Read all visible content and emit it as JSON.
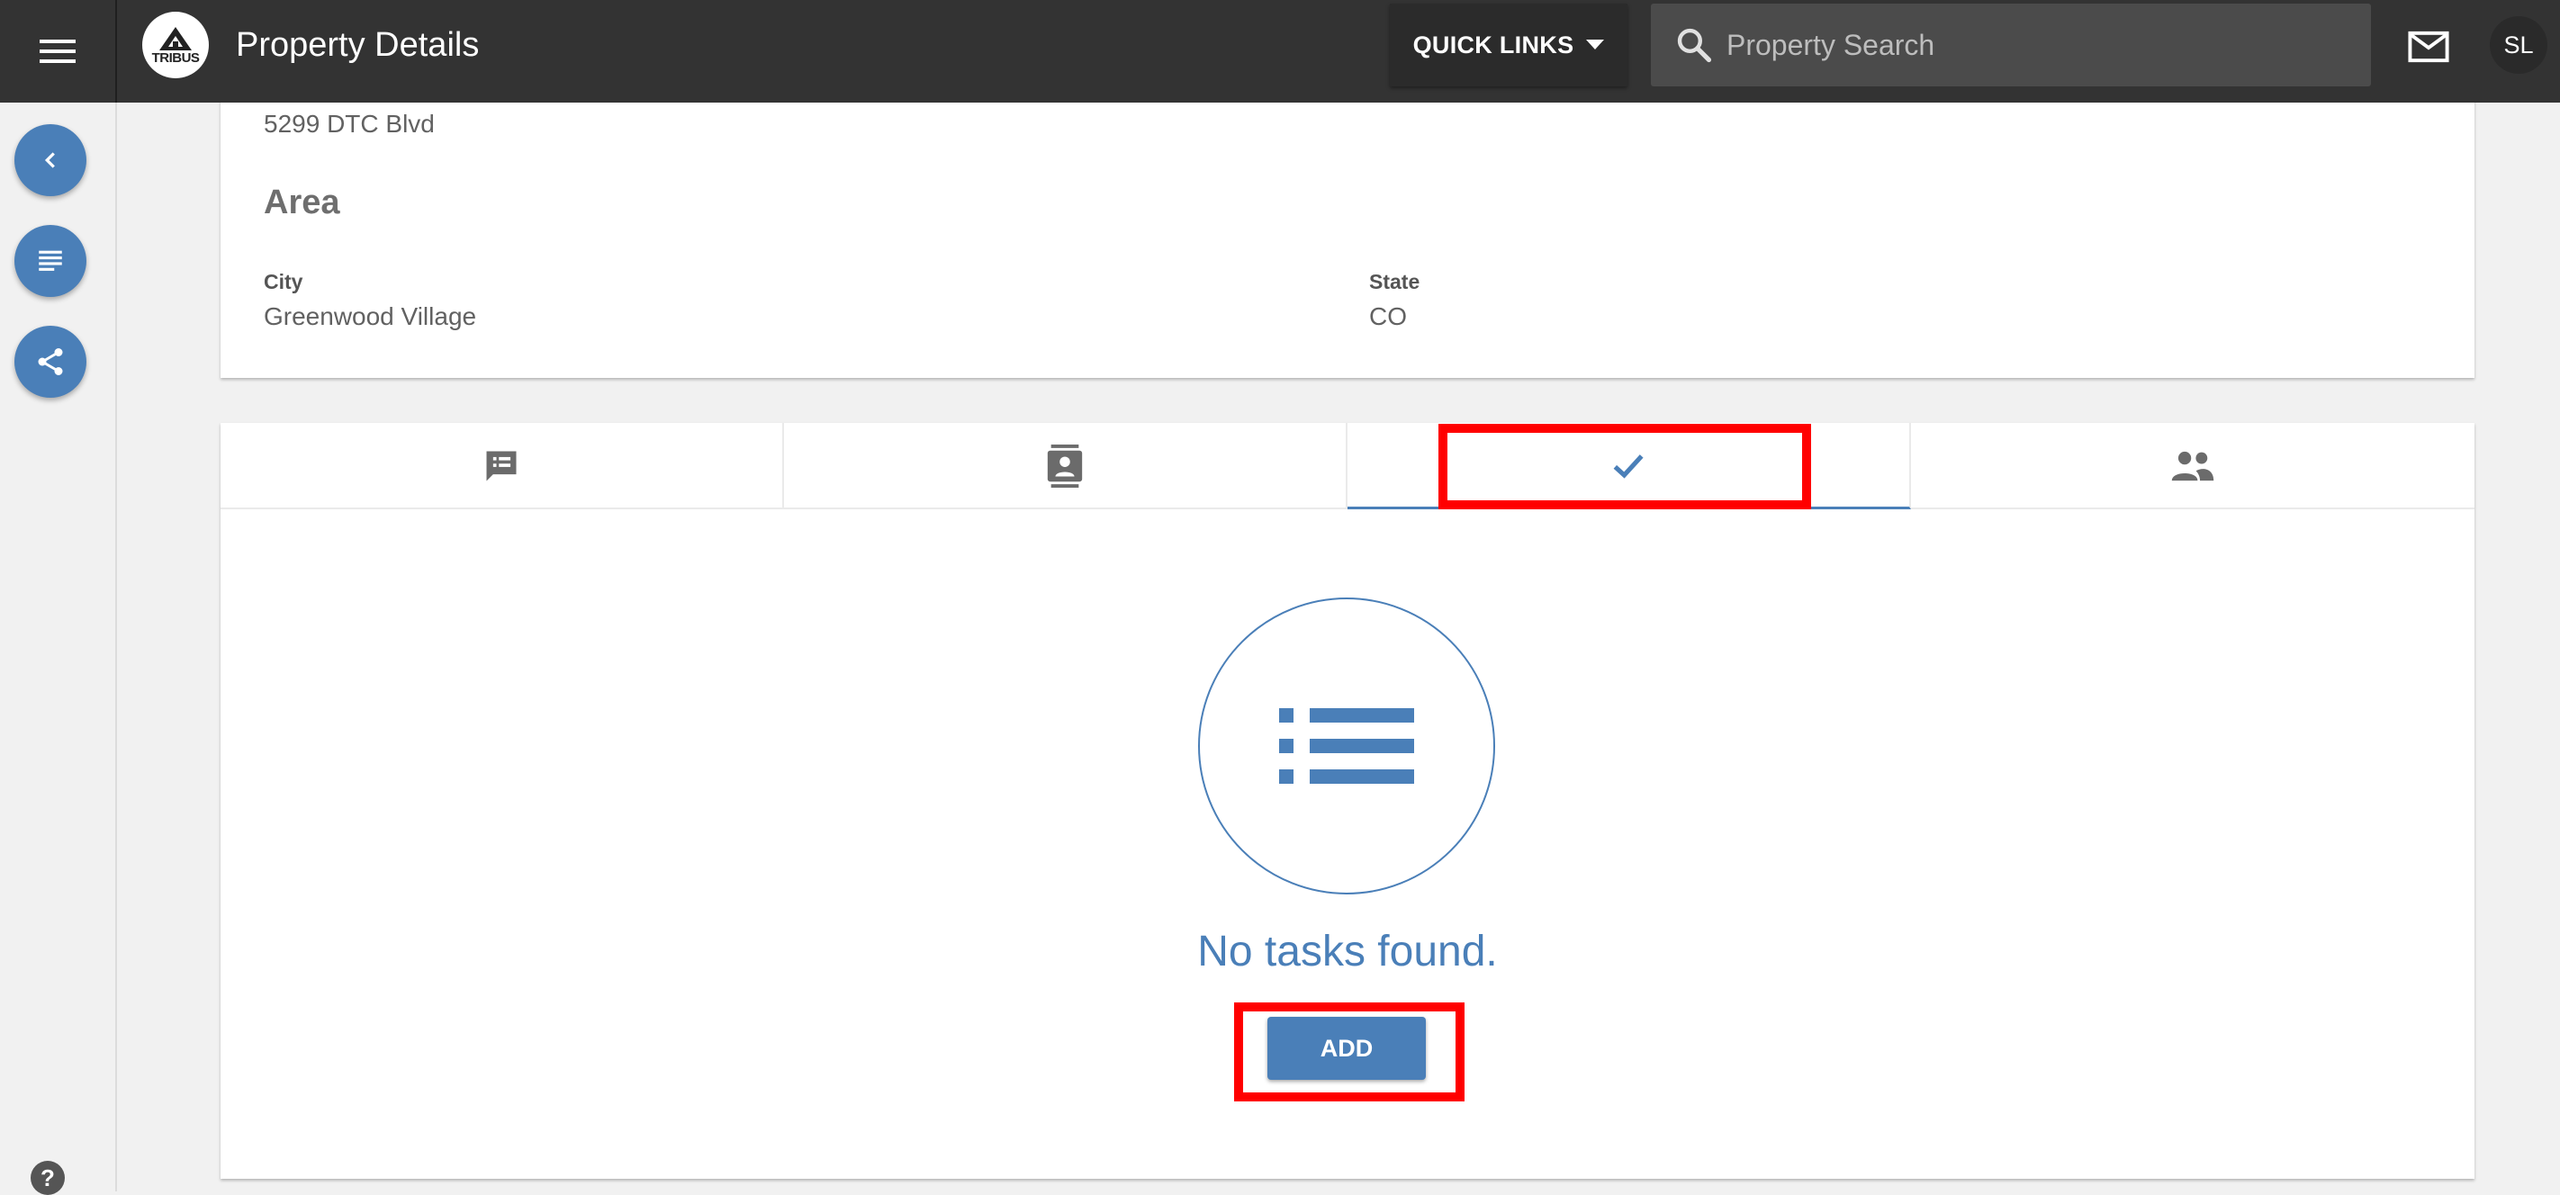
{
  "header": {
    "menu_icon": "hamburger-menu-icon",
    "logo_text": "TRIBUS",
    "title": "Property Details",
    "quick_links_label": "QUICK LINKS",
    "search_placeholder": "Property Search",
    "mail_icon": "mail-icon",
    "avatar_initials": "SL"
  },
  "sidebar": {
    "buttons": [
      {
        "icon": "chevron-left-icon"
      },
      {
        "icon": "document-lines-icon"
      },
      {
        "icon": "share-icon"
      }
    ],
    "help_label": "?"
  },
  "property": {
    "address": "5299 DTC Blvd",
    "area_heading": "Area",
    "city_label": "City",
    "city_value": "Greenwood Village",
    "state_label": "State",
    "state_value": "CO"
  },
  "tabs": [
    {
      "icon": "notes-icon",
      "active": false
    },
    {
      "icon": "contacts-icon",
      "active": false
    },
    {
      "icon": "checkmark-icon",
      "active": true
    },
    {
      "icon": "people-icon",
      "active": false
    }
  ],
  "tasks": {
    "empty_icon": "list-icon",
    "empty_message": "No tasks found.",
    "add_label": "ADD"
  },
  "colors": {
    "accent": "#4a7fb8",
    "topbar": "#333333",
    "highlight": "#ff0000"
  }
}
